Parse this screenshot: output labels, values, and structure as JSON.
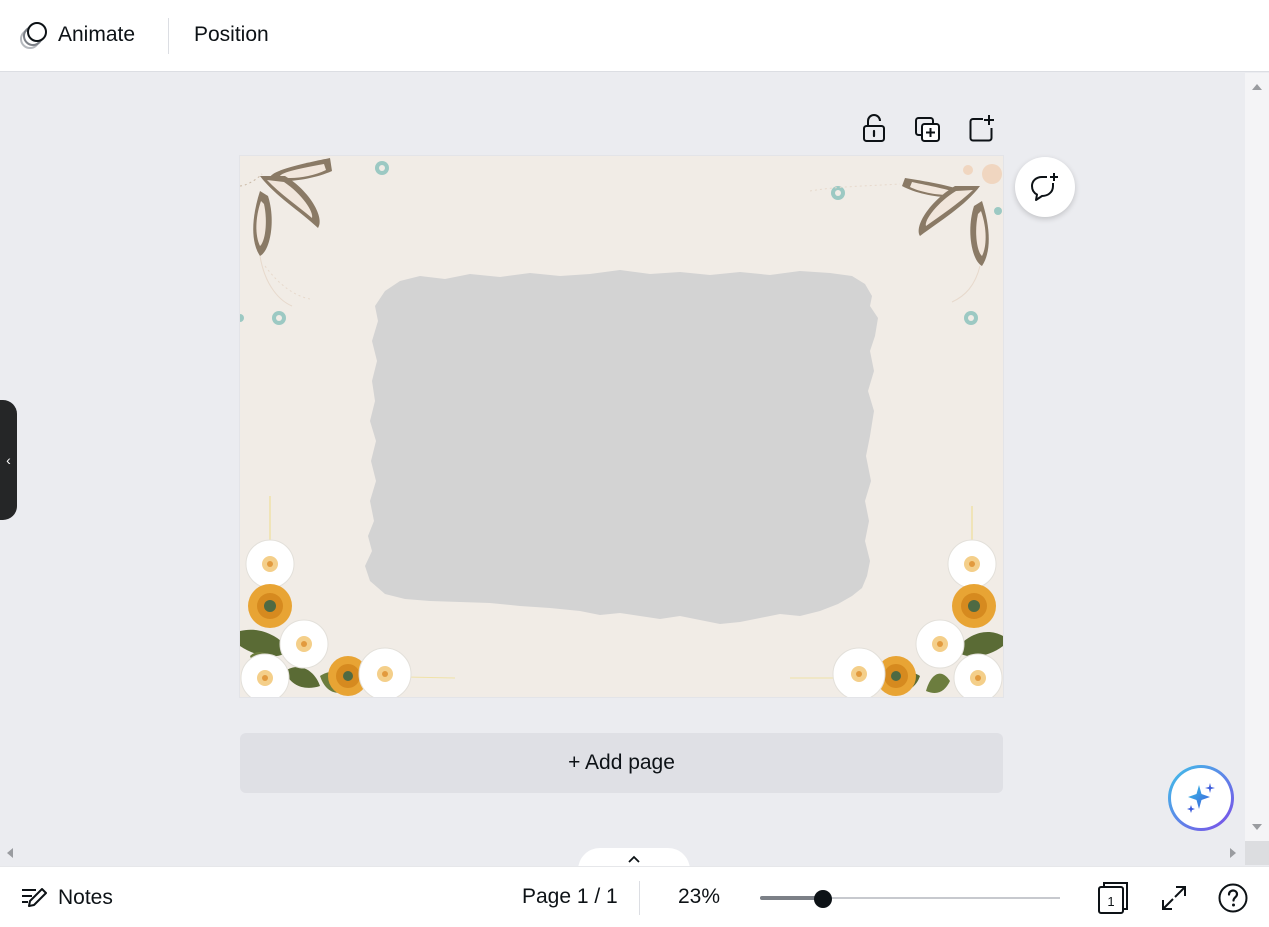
{
  "toolbar": {
    "animate_label": "Animate",
    "position_label": "Position"
  },
  "page_tools": {
    "lock_icon": "lock-open-icon",
    "duplicate_icon": "duplicate-page-icon",
    "add_icon": "add-page-icon"
  },
  "canvas": {
    "background": "#f1ece6",
    "photo_placeholder_color": "#d3d3d3"
  },
  "add_page_label": "+ Add page",
  "bottombar": {
    "notes_label": "Notes",
    "page_indicator": "Page 1 / 1",
    "zoom_level": "23%",
    "zoom_fraction": 0.21,
    "grid_page_count": "1"
  },
  "colors": {
    "ink": "#0d1216",
    "workspace": "#ebecf0",
    "magic_gradient_start": "#3dc3e8",
    "magic_gradient_end": "#7d4ae8"
  }
}
